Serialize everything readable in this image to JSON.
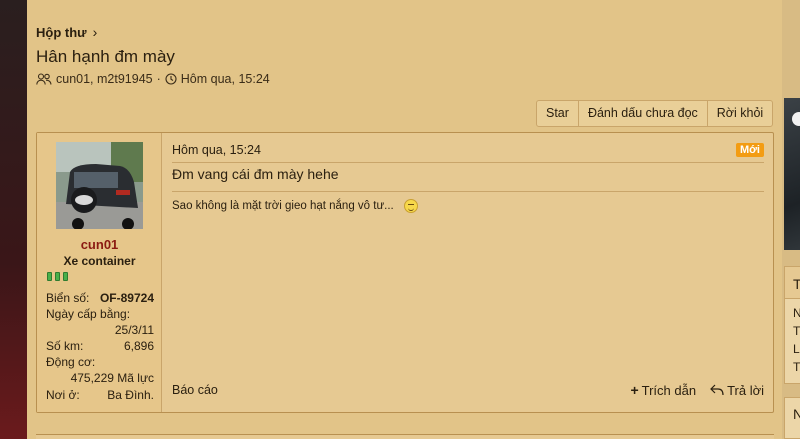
{
  "breadcrumb": {
    "label": "Hộp thư",
    "chevron": "›"
  },
  "thread": {
    "title": "Hân hạnh đm mày",
    "participants": "cun01, m2t91945",
    "separator": "·",
    "date": "Hôm qua, 15:24"
  },
  "actions": {
    "star": "Star",
    "mark_unread": "Đánh dấu chưa đọc",
    "leave": "Rời khỏi"
  },
  "message": {
    "date": "Hôm qua, 15:24",
    "new_badge": "Mới",
    "body": "Đm vang cái đm mày hehe",
    "signature": "Sao không là mặt trời gieo hạt nắng vô tư...",
    "report": "Báo cáo",
    "quote": "Trích dẫn",
    "reply": "Trả lời"
  },
  "user": {
    "name": "cun01",
    "title": "Xe container",
    "stats": {
      "plate_label": "Biển số:",
      "plate_value": "OF-89724",
      "joined_label": "Ngày cấp bằng:",
      "joined_value": "25/3/11",
      "km_label": "Số km:",
      "km_value": "6,896",
      "engine_label": "Động cơ:",
      "engine_value": "475,229 Mã lực",
      "location_label": "Nơi ở:",
      "location_value": "Ba Đình."
    }
  },
  "sidebar": {
    "box1_header": "T",
    "box1_lines": [
      "N",
      "Ti",
      "La",
      "Ti"
    ],
    "box2_header": "N"
  },
  "colors": {
    "background": "#e2c488",
    "username": "#8b1a12",
    "new_badge": "#f39c12",
    "pip": "#49b04a"
  }
}
